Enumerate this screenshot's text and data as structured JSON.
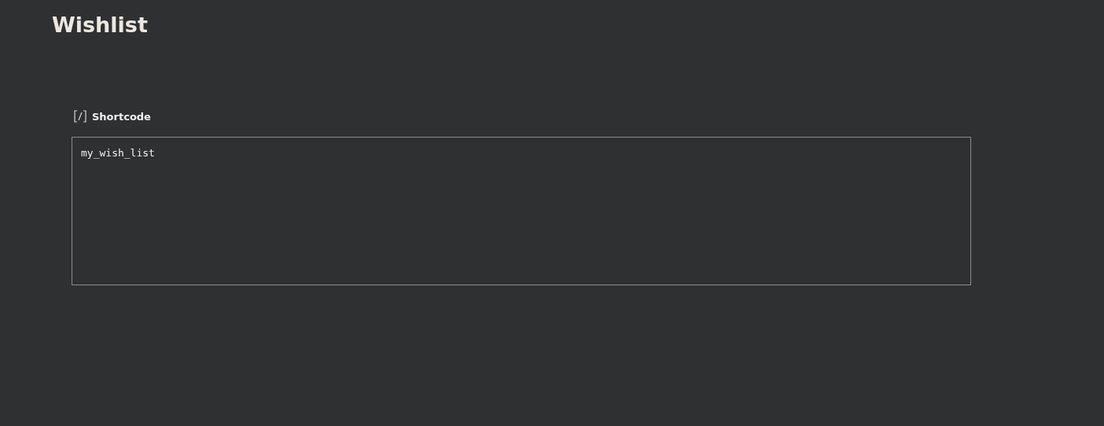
{
  "page": {
    "title": "Wishlist"
  },
  "block": {
    "label": "Shortcode",
    "value": "my_wish_list"
  }
}
